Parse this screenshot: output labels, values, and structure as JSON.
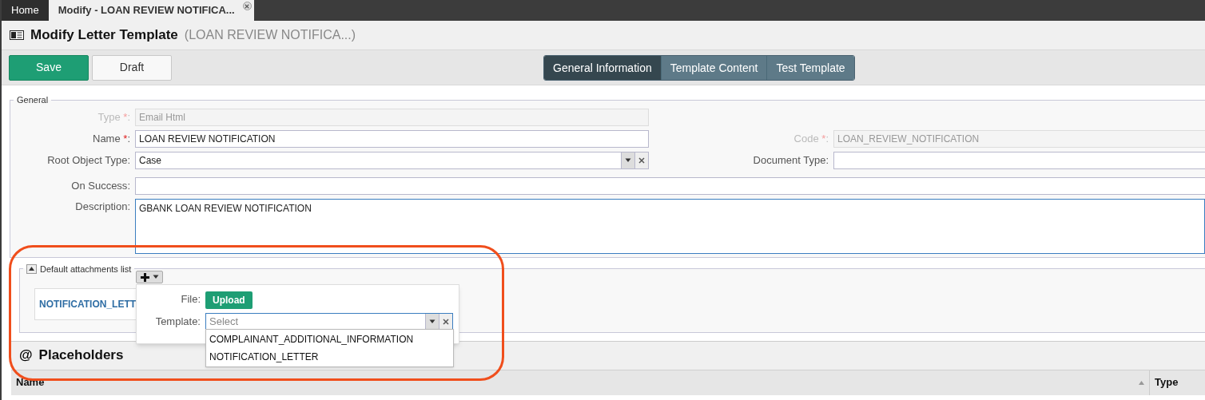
{
  "tabs": [
    {
      "label": "Home",
      "selected": false,
      "closable": false
    },
    {
      "label": "Modify - LOAN REVIEW NOTIFICA...",
      "selected": true,
      "closable": true
    }
  ],
  "header": {
    "title": "Modify Letter Template",
    "subtitle": "(LOAN REVIEW NOTIFICA...)"
  },
  "toolbar": {
    "buttons": [
      {
        "label": "Save",
        "kind": "primary"
      },
      {
        "label": "Draft",
        "kind": "default"
      }
    ],
    "views": [
      {
        "label": "General Information",
        "selected": true
      },
      {
        "label": "Template Content",
        "selected": false
      },
      {
        "label": "Test Template",
        "selected": false
      }
    ]
  },
  "general": {
    "legend": "General",
    "rows": [
      {
        "left": {
          "label": "Type",
          "required_mark": "*",
          "colon": ":",
          "value": "Email Html",
          "kind": "text",
          "disabled": true
        }
      },
      {
        "left": {
          "label": "Name",
          "required_mark": "*",
          "colon": ":",
          "value": "LOAN REVIEW NOTIFICATION",
          "kind": "text",
          "disabled": false
        },
        "right": {
          "label": "Code",
          "required_mark": "*",
          "colon": ":",
          "value": "LOAN_REVIEW_NOTIFICATION",
          "kind": "text",
          "disabled": true
        }
      },
      {
        "left": {
          "label": "Root Object Type",
          "colon": ":",
          "value": "Case",
          "kind": "select",
          "disabled": false
        },
        "right": {
          "label": "Document Type",
          "colon": ":",
          "kind": "text",
          "disabled": false
        }
      },
      {
        "wide": {
          "label": "On Success",
          "colon": ":",
          "kind": "text",
          "disabled": false
        }
      },
      {
        "wide": {
          "label": "Description",
          "colon": ":",
          "value": "GBANK LOAN REVIEW NOTIFICATION",
          "kind": "textarea"
        }
      }
    ]
  },
  "attachments": {
    "legend": "Default attachments list",
    "expanded": true,
    "items": [
      "NOTIFICATION_LETT"
    ],
    "add_popup": {
      "file_label": "File:",
      "upload": "Upload",
      "template_label": "Template:",
      "template_placeholder": "Select",
      "options": [
        "COMPLAINANT_ADDITIONAL_INFORMATION",
        "NOTIFICATION_LETTER"
      ]
    }
  },
  "placeholders": {
    "icon": "@",
    "title": "Placeholders",
    "columns": [
      {
        "label": "Name",
        "sorted": true
      },
      {
        "label": "Type",
        "sorted": false
      }
    ]
  }
}
